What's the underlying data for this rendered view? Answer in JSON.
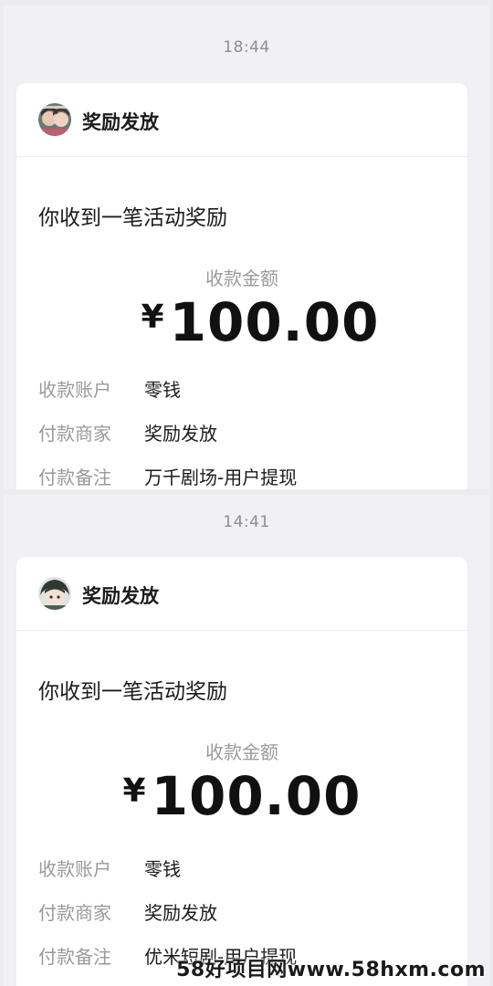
{
  "screenshots": [
    {
      "time": "18:44",
      "sender_name": "奖励发放",
      "headline": "你收到一笔活动奖励",
      "amount_label": "收款金额",
      "currency_symbol": "¥",
      "amount": "100.00",
      "details": [
        {
          "label": "收款账户",
          "value": "零钱"
        },
        {
          "label": "付款商家",
          "value": "奖励发放"
        },
        {
          "label": "付款备注",
          "value": "万千剧场-用户提现"
        }
      ]
    },
    {
      "time": "14:41",
      "sender_name": "奖励发放",
      "headline": "你收到一笔活动奖励",
      "amount_label": "收款金额",
      "currency_symbol": "¥",
      "amount": "100.00",
      "details": [
        {
          "label": "收款账户",
          "value": "零钱"
        },
        {
          "label": "付款商家",
          "value": "奖励发放"
        },
        {
          "label": "付款备注",
          "value": "优米短剧-用户提现"
        }
      ]
    }
  ],
  "watermark": "58好项目网www.58hxm.com",
  "colors": {
    "background": "#ececef",
    "card": "#ffffff",
    "muted_text": "#9a9a9a",
    "primary_text": "#1b1b1b"
  },
  "icons": [
    "avatar-anime-couple",
    "avatar-anime-character"
  ]
}
